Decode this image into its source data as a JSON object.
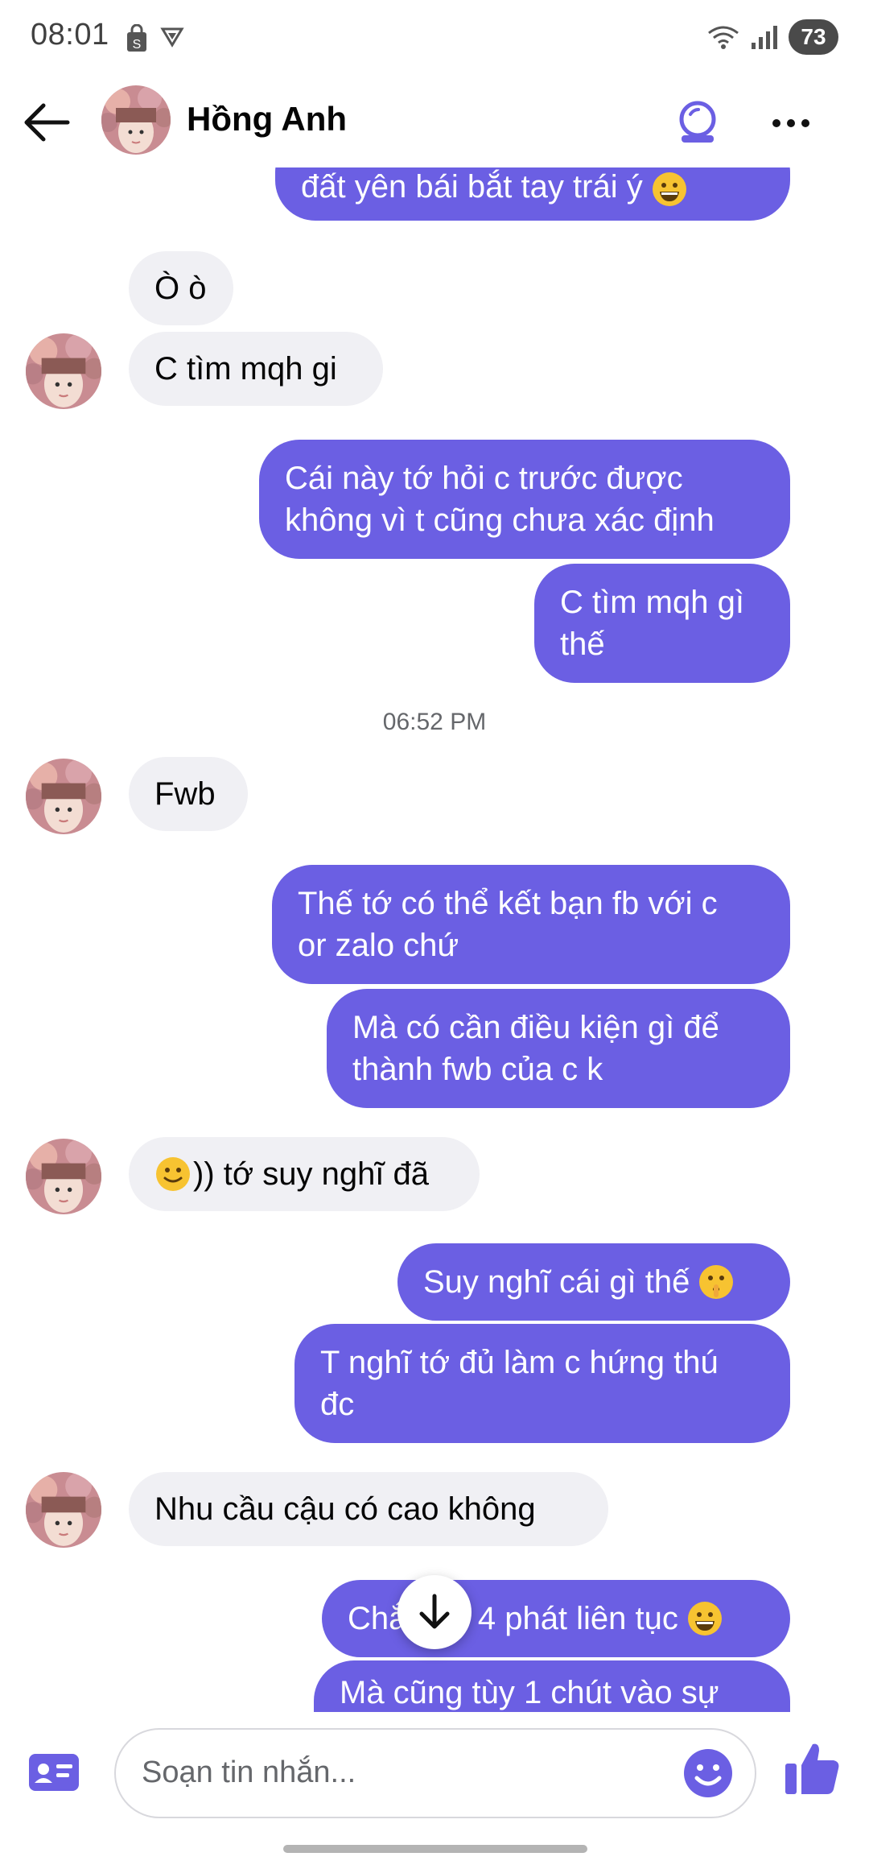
{
  "status_bar": {
    "time": "08:01",
    "battery": "73"
  },
  "header": {
    "contact_name": "Hồng Anh"
  },
  "messages": [
    {
      "text": "đất yên bái bắt tay trái ý"
    },
    {
      "text": "Ò ò"
    },
    {
      "text": "C tìm mqh gi"
    },
    {
      "text": "Cái này tớ hỏi c trước được\nkhông vì t cũng chưa xác định"
    },
    {
      "text": "C tìm mqh gì\nthế"
    },
    {
      "text": "Fwb"
    },
    {
      "text": "Thế tớ có thể kết bạn fb với c\nor zalo chứ"
    },
    {
      "text": "Mà có cần điều kiện gì để\nthành fwb của c k"
    },
    {
      "text": ")) tớ suy nghĩ đã"
    },
    {
      "text": "Suy nghĩ cái gì thế"
    },
    {
      "text": "T nghĩ tớ đủ làm c hứng thú\nđc"
    },
    {
      "text": "Nhu cầu cậu có cao không"
    },
    {
      "text": "Chắc cỡ 4 phát liên tục"
    },
    {
      "text": "Mà cũng tùy 1 chút vào sự"
    }
  ],
  "timestamp": "06:52 PM",
  "composer": {
    "placeholder": "Soạn tin nhắn..."
  },
  "colors": {
    "outgoing_bubble": "#6b5fe3",
    "incoming_bubble": "#f0f0f4",
    "accent": "#6b5fe3"
  },
  "icons": [
    "back-arrow-icon",
    "theme-icon",
    "more-icon",
    "scroll-down-icon",
    "contact-card-icon",
    "emoji-icon",
    "like-icon"
  ]
}
